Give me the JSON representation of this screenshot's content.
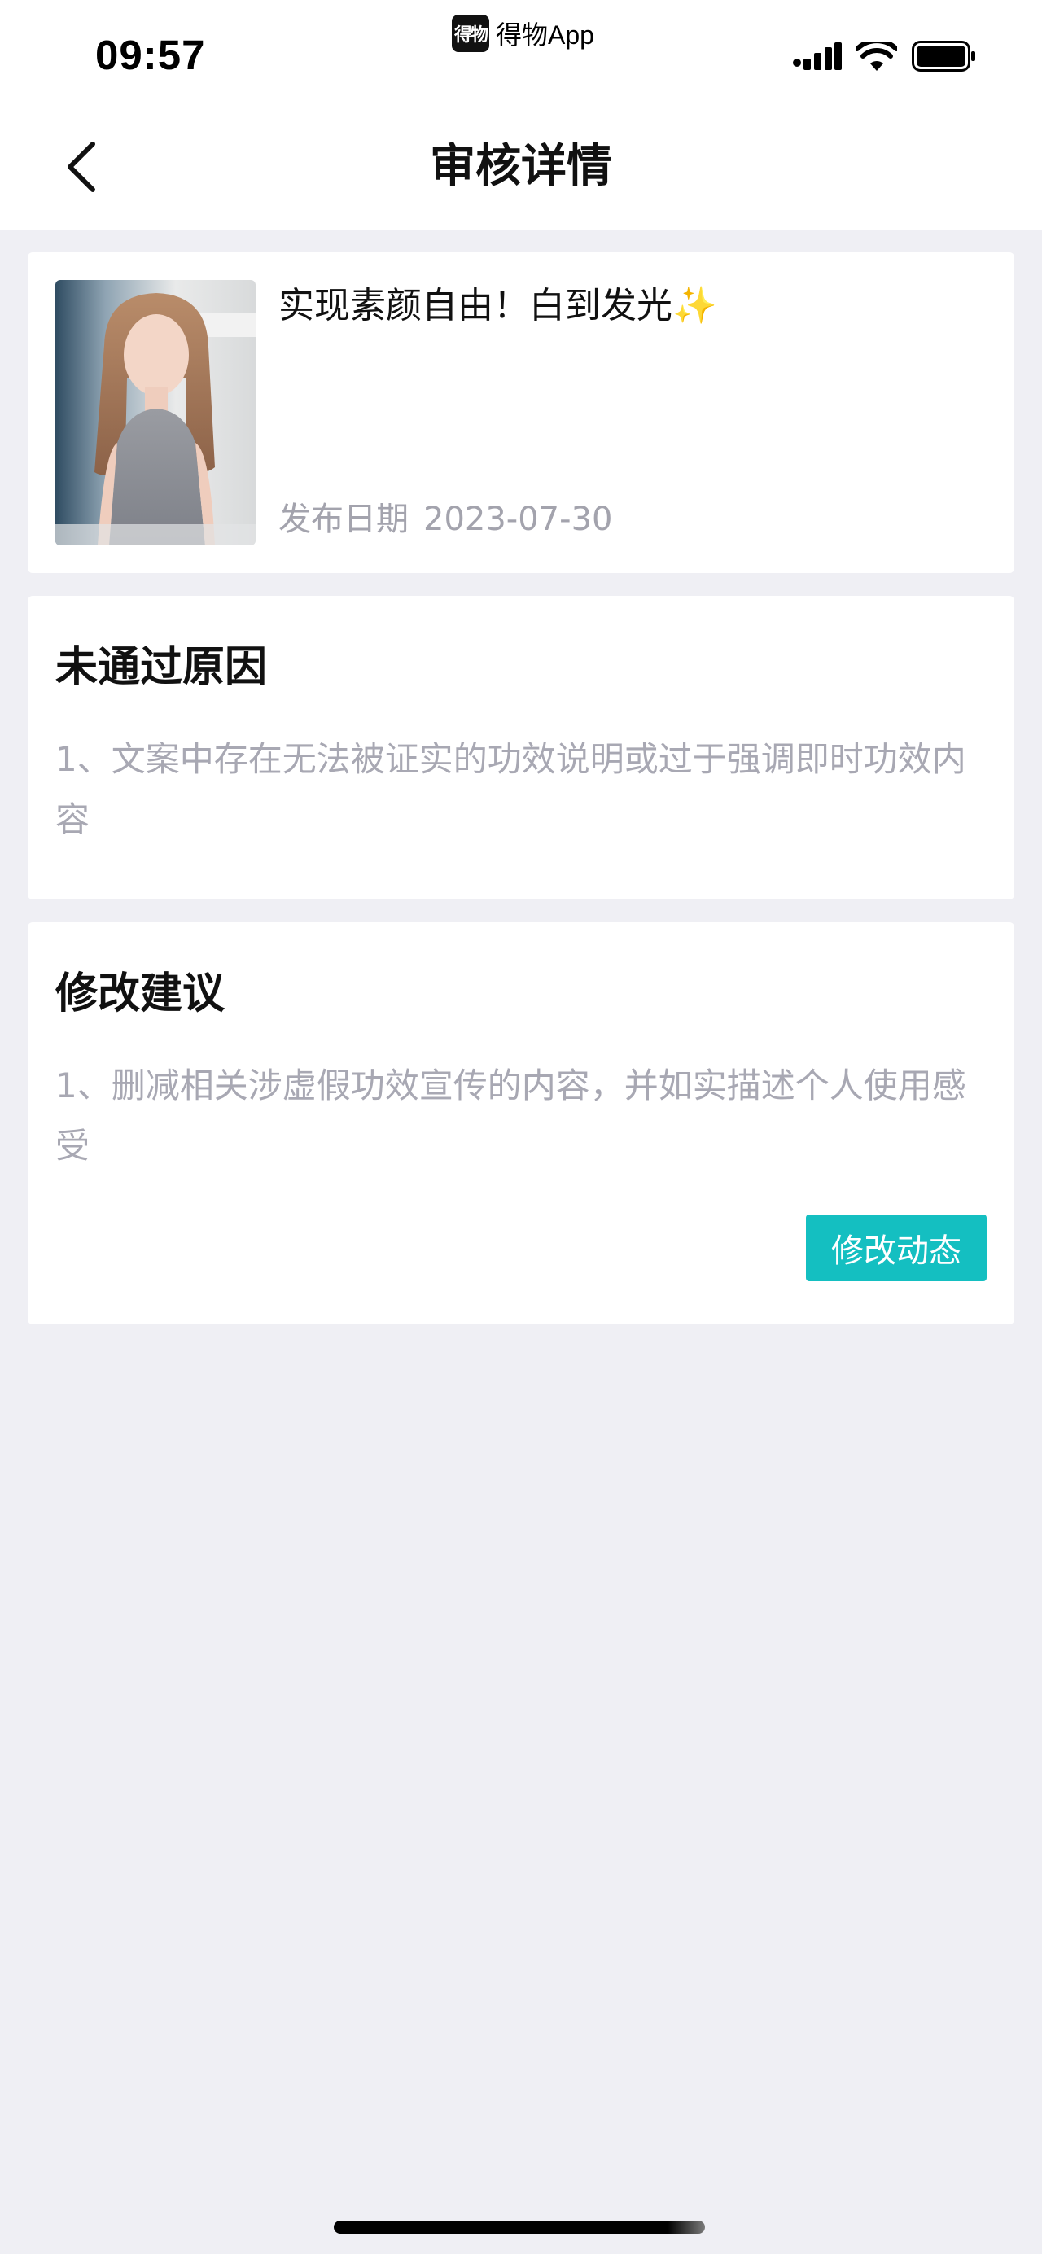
{
  "status_bar": {
    "time": "09:57",
    "app_logo_text": "得物",
    "app_name": "得物App",
    "icons": [
      "cellular-signal-icon",
      "wifi-icon",
      "battery-icon"
    ]
  },
  "nav": {
    "back_icon": "chevron-left-icon",
    "title": "审核详情"
  },
  "post": {
    "thumbnail": "portrait-photo",
    "title": "实现素颜自由！白到发光✨",
    "publish_label": "发布日期",
    "publish_date": "2023-07-30"
  },
  "rejection": {
    "title": "未通过原因",
    "body": "1、文案中存在无法被证实的功效说明或过于强调即时功效内容"
  },
  "suggestion": {
    "title": "修改建议",
    "body": "1、删减相关涉虚假功效宣传的内容，并如实描述个人使用感受",
    "button_label": "修改动态"
  },
  "colors": {
    "accent": "#14bfc1",
    "page_bg": "#efeff4",
    "muted_text": "#a8a8b3"
  }
}
